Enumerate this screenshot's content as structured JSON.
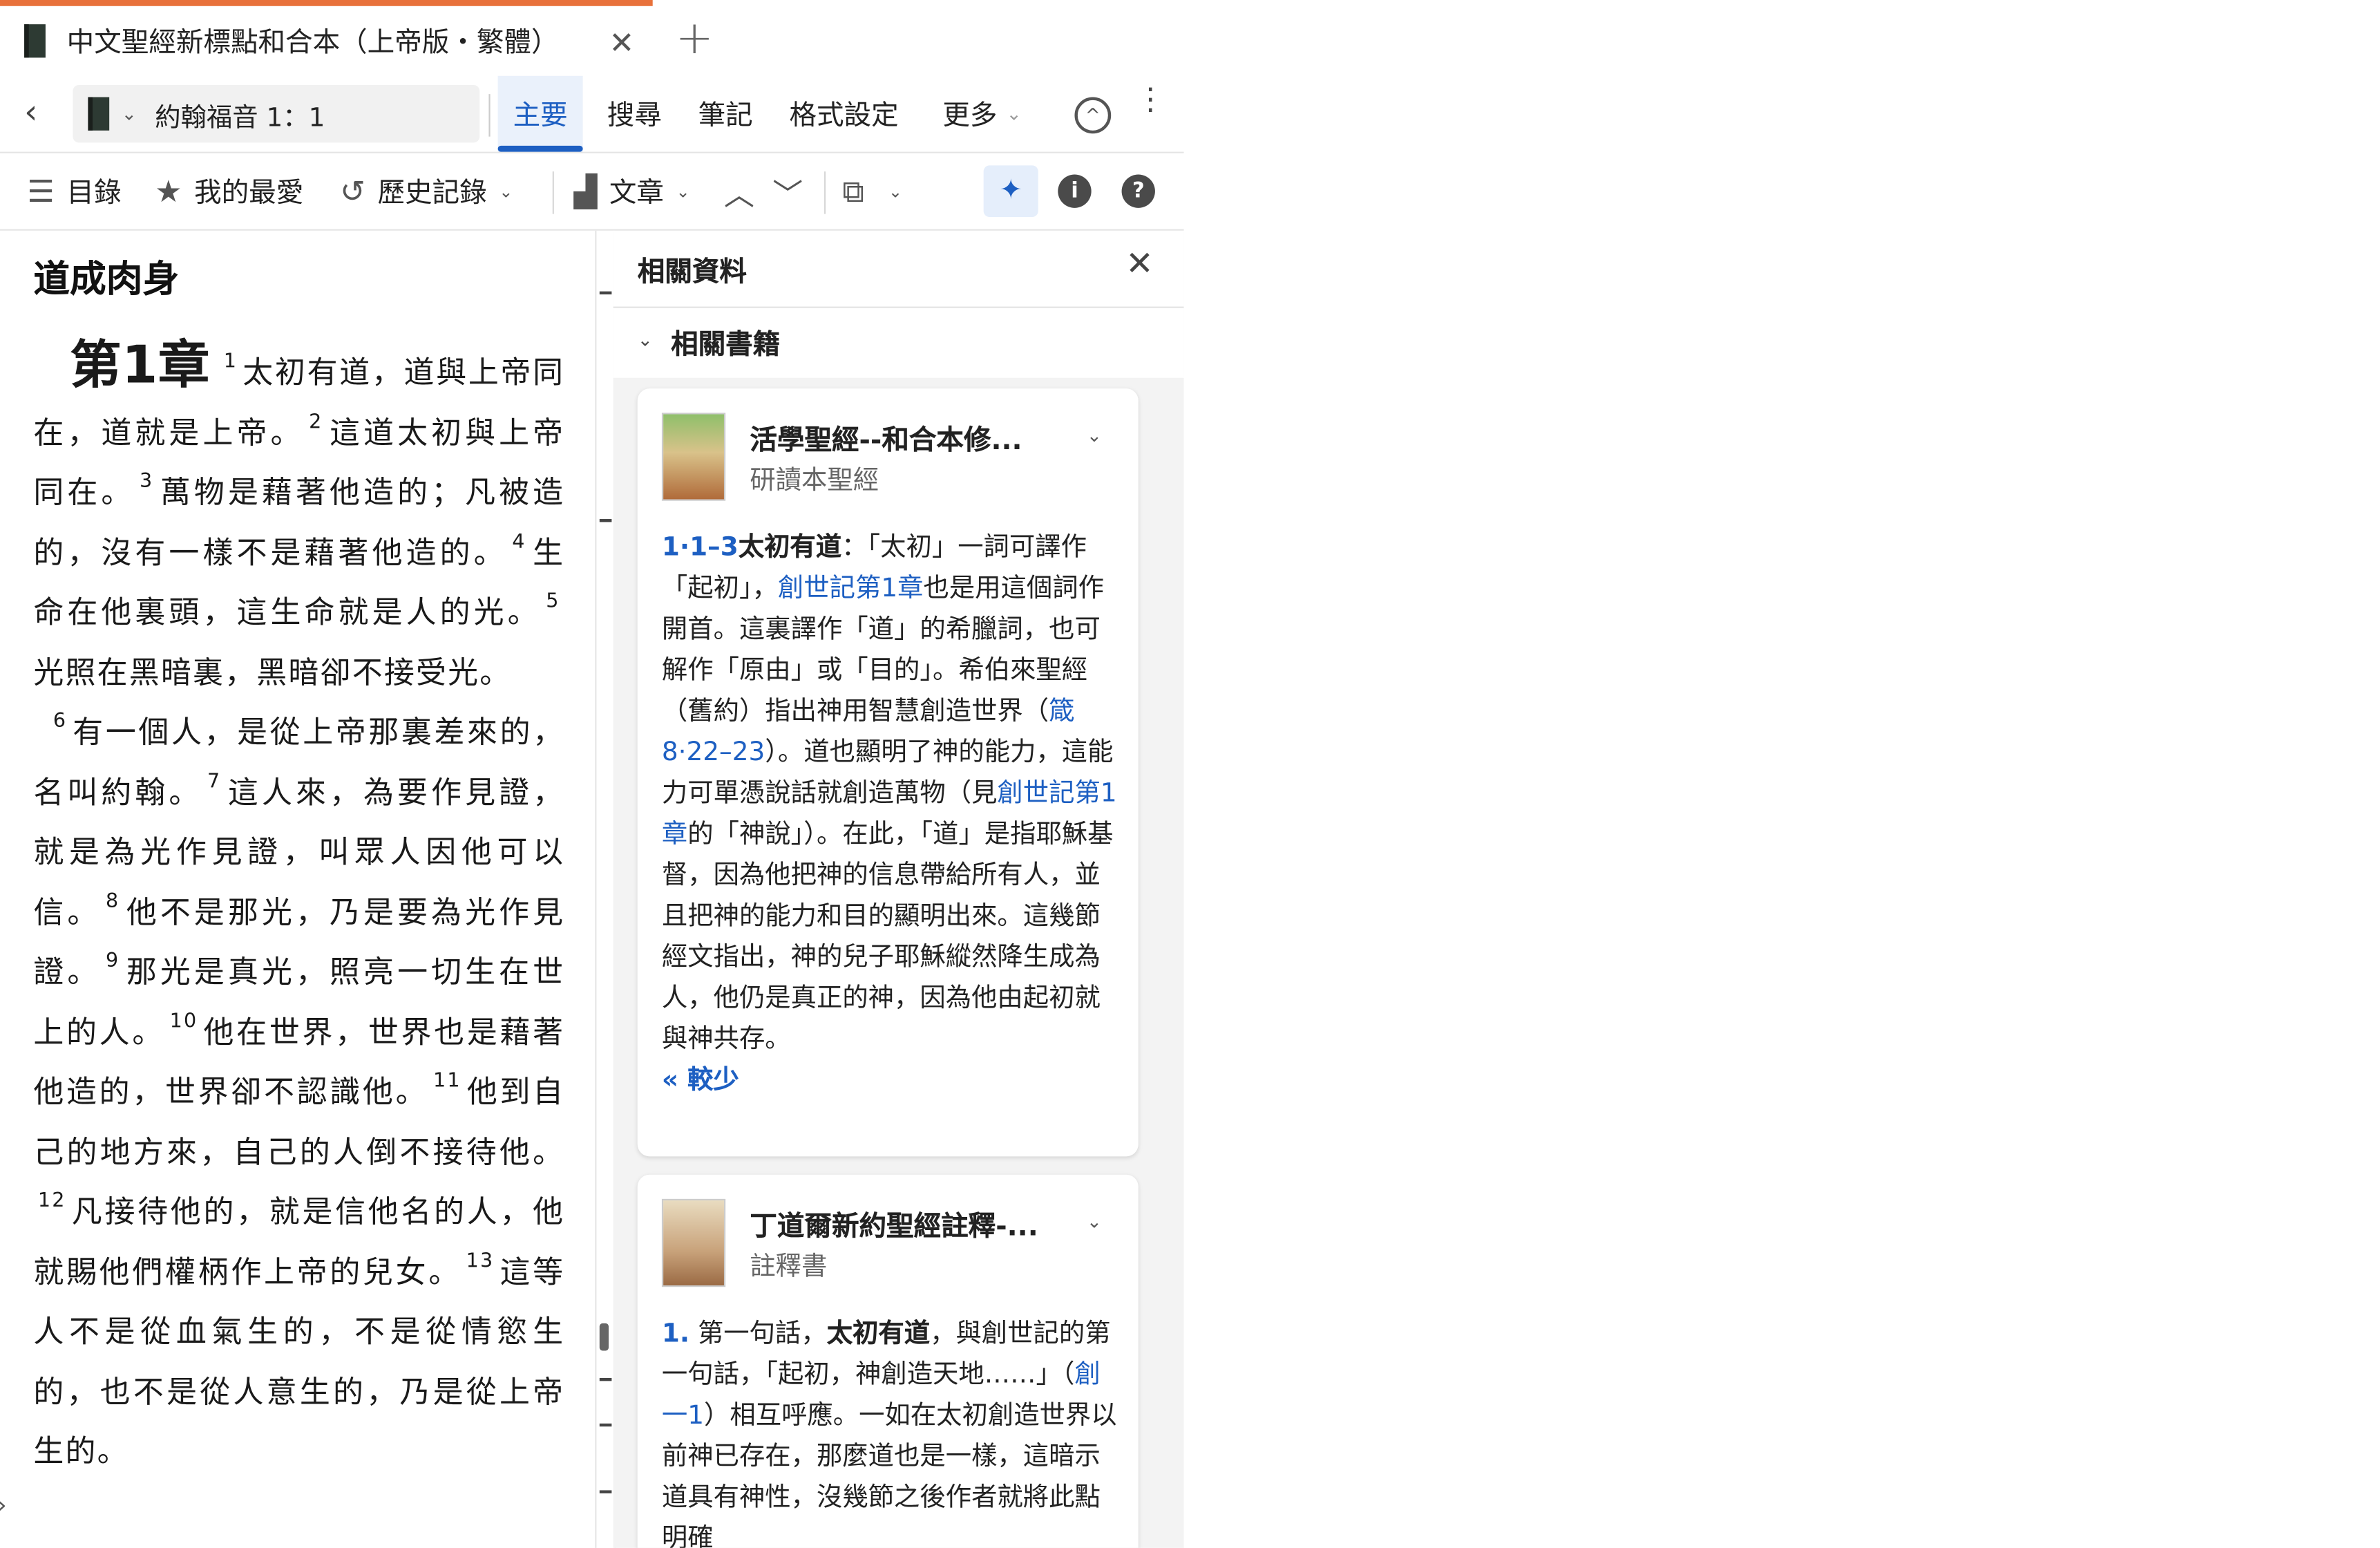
{
  "tab": {
    "title": "中文聖經新標點和合本（上帝版・繁體）",
    "close": "✕",
    "new_tab": "+"
  },
  "nav": {
    "reference": "約翰福音 1：1",
    "tabs": [
      {
        "label": "主要"
      },
      {
        "label": "搜尋"
      },
      {
        "label": "筆記"
      },
      {
        "label": "格式設定"
      },
      {
        "label": "更多"
      }
    ]
  },
  "toolbar": {
    "contents": "目錄",
    "favorites": "我的最愛",
    "history": "歷史記錄",
    "text_mode": "文章"
  },
  "reader": {
    "heading": "道成肉身",
    "chapter": "第1章",
    "verses": [
      {
        "n": "1",
        "t": "太初有道，道與上帝同在，道就是上帝。"
      },
      {
        "n": "2",
        "t": "這道太初與上帝同在。"
      },
      {
        "n": "3",
        "t": "萬物是藉著他造的；凡被造的，沒有一樣不是藉著他造的。"
      },
      {
        "n": "4",
        "t": "生命在他裏頭，這生命就是人的光。"
      },
      {
        "n": "5",
        "t": "光照在黑暗裏，黑暗卻不接受光。"
      },
      {
        "n": "6",
        "t": "有一個人，是從上帝那裏差來的，名叫約翰。"
      },
      {
        "n": "7",
        "t": "這人來，為要作見證，就是為光作見證，叫眾人因他可以信。"
      },
      {
        "n": "8",
        "t": "他不是那光，乃是要為光作見證。"
      },
      {
        "n": "9",
        "t": "那光是真光，照亮一切生在世上的人。"
      },
      {
        "n": "10",
        "t": "他在世界，世界也是藉著他造的，世界卻不認識他。"
      },
      {
        "n": "11",
        "t": "他到自己的地方來，自己的人倒不接待他。"
      },
      {
        "n": "12",
        "t": "凡接待他的，就是信他名的人，他就賜他們權柄作上帝的兒女。"
      },
      {
        "n": "13",
        "t": "這等人不是從血氣生的，不是從情慾生的，也不是從人意生的，乃是從上帝生的。"
      }
    ]
  },
  "panel": {
    "title": "相關資料",
    "section": "相關書籍",
    "cards": [
      {
        "title": "活學聖經--和合本修...",
        "subtitle": "研讀本聖經",
        "ref": "1·1–3",
        "bold": "太初有道",
        "t1": "：「太初」一詞可譯作「起初」，",
        "link1": "創世記第1章",
        "t2": "也是用這個詞作開首。這裏譯作「道」的希臘詞，也可解作「原由」或「目的」。希伯來聖經（舊約）指出神用智慧創造世界（",
        "link2": "箴8·22–23",
        "t3": "）。道也顯明了神的能力，這能力可單憑說話就創造萬物（見",
        "link3": "創世記第1章",
        "t4": "的「神說」）。在此，「道」是指耶穌基督，因為他把神的信息帶給所有人，並且把神的能力和目的顯明出來。這幾節經文指出，神的兒子耶穌縱然降生成為人，他仍是真正的神，因為他由起初就與神共存。",
        "less": "« 較少"
      },
      {
        "title": "丁道爾新約聖經註釋-...",
        "subtitle": "註釋書",
        "ref": "1.",
        "t1": " 第一句話，",
        "bold": "太初有道",
        "t2": "，與創世記的第一句話，「起初，神創造天地……」（",
        "link1": "創一1",
        "t3": "）相互呼應。一如在太初創造世界以前神已存在，那麼道也是一樣，這暗示道具有神性，沒幾節之後作者就將此點明確"
      }
    ]
  },
  "colors": {
    "accent": "#1d5fc2",
    "tab_accent": "#e8713b",
    "panel_bg": "#f3f3f3"
  }
}
